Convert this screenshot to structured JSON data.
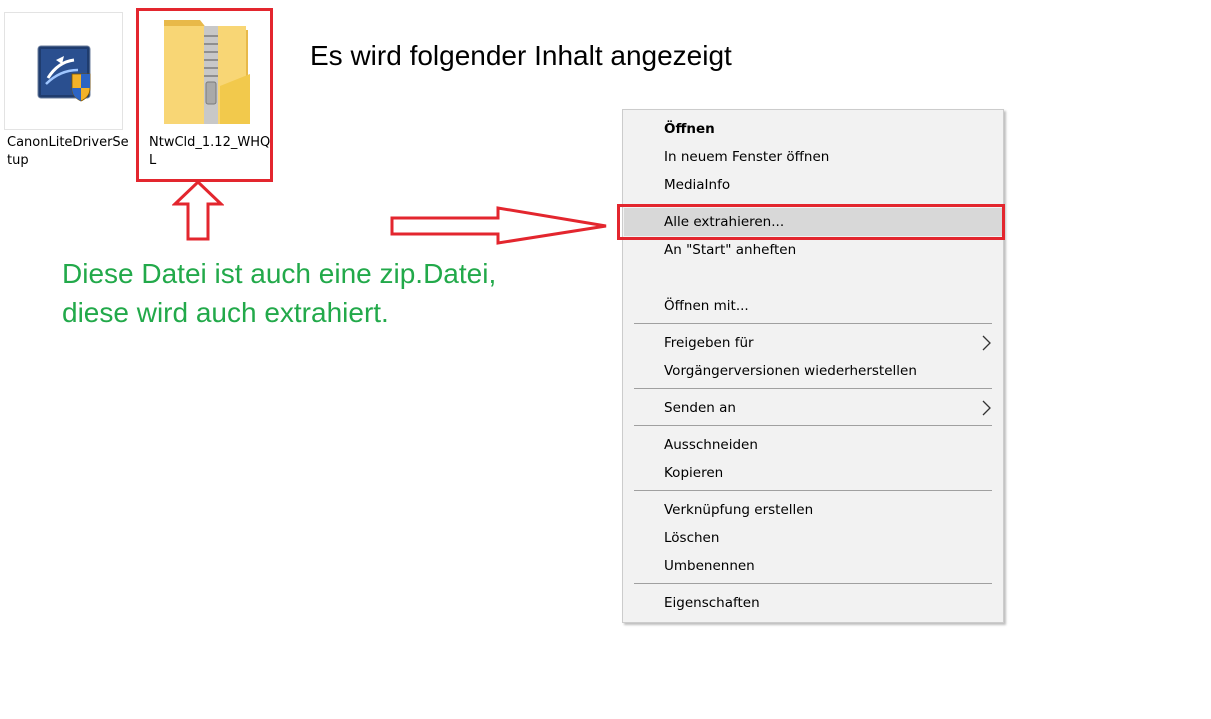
{
  "files": [
    {
      "label": "CanonLiteDriverSetup",
      "icon": "installer-shield-icon"
    },
    {
      "label": "NtwCld_1.12_WHQL",
      "icon": "zip-folder-icon"
    }
  ],
  "annotations": {
    "heading": "Es wird folgender Inhalt angezeigt",
    "note_line1": "Diese Datei ist auch eine zip.Datei,",
    "note_line2": "diese wird auch extrahiert.",
    "note_color": "#22a94a",
    "highlight_color": "#e3262e"
  },
  "context_menu": {
    "items": [
      {
        "label": "Öffnen",
        "bold": true
      },
      {
        "label": "In neuem Fenster öffnen"
      },
      {
        "label": "MediaInfo"
      },
      {
        "label": "Alle extrahieren...",
        "highlighted": true
      },
      {
        "label": "An \"Start\" anheften"
      },
      {
        "label": "Öffnen mit..."
      },
      {
        "label": "Freigeben für",
        "submenu": true
      },
      {
        "label": "Vorgängerversionen wiederherstellen"
      },
      {
        "label": "Senden an",
        "submenu": true
      },
      {
        "label": "Ausschneiden"
      },
      {
        "label": "Kopieren"
      },
      {
        "label": "Verknüpfung erstellen"
      },
      {
        "label": "Löschen"
      },
      {
        "label": "Umbenennen"
      },
      {
        "label": "Eigenschaften"
      }
    ]
  }
}
